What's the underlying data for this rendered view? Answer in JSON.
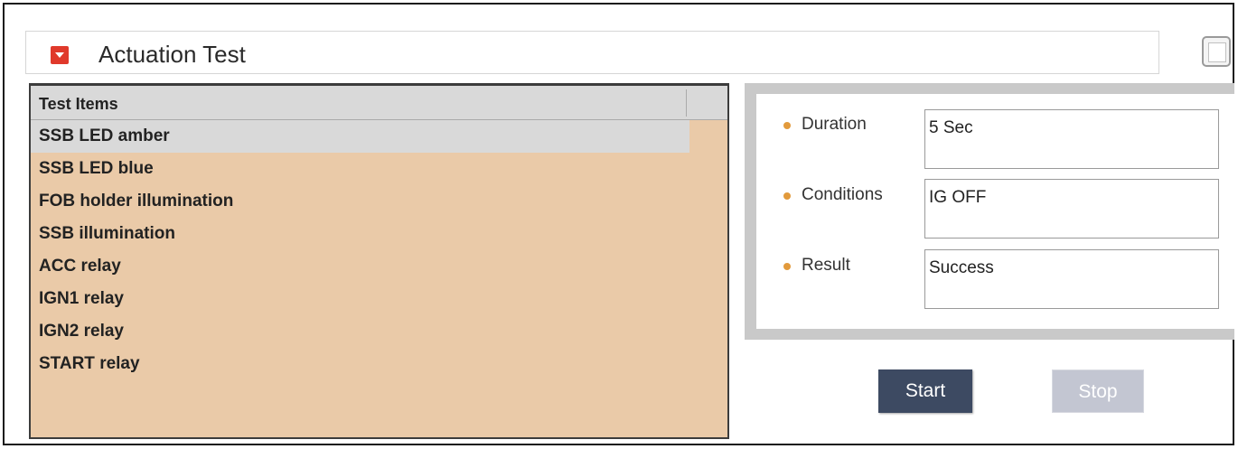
{
  "panel": {
    "title": "Actuation Test",
    "collapse_icon": "collapse-arrow-icon"
  },
  "colors": {
    "list_background": "#eacaa8",
    "header_background": "#d9d9d9",
    "collapse_icon": "#e0392b",
    "bullet": "#e29a3c",
    "start_button": "#3d4a62",
    "stop_button_disabled": "#c3c6d2"
  },
  "test_list": {
    "header": "Test Items",
    "selected_index": 0,
    "items": [
      "SSB LED amber",
      "SSB LED blue",
      "FOB holder illumination",
      "SSB  illumination",
      "ACC relay",
      "IGN1 relay",
      "IGN2 relay",
      "START relay"
    ]
  },
  "details": {
    "fields": [
      {
        "label": "Duration",
        "value": "5 Sec"
      },
      {
        "label": "Conditions",
        "value": "IG OFF"
      },
      {
        "label": "Result",
        "value": "Success"
      }
    ]
  },
  "actions": {
    "start_label": "Start",
    "stop_label": "Stop",
    "stop_enabled": false
  }
}
